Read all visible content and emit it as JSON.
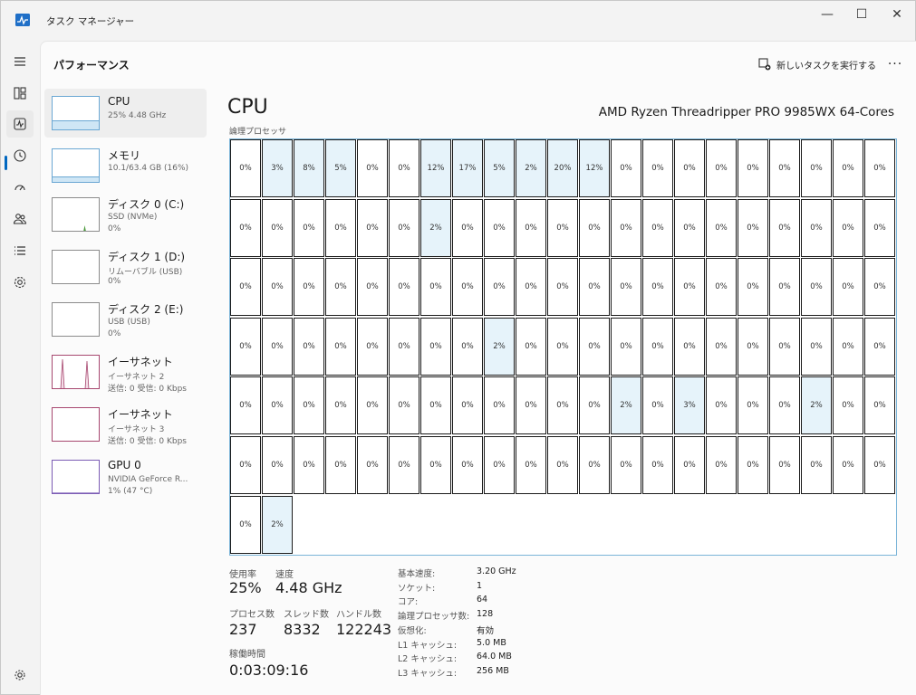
{
  "app": {
    "title": "タスク マネージャー"
  },
  "header": {
    "page_title": "パフォーマンス",
    "run_task_label": "新しいタスクを実行する",
    "more_label": "···"
  },
  "window_controls": {
    "minimize": "—",
    "maximize": "☐",
    "close": "✕"
  },
  "rail": {
    "items": [
      "menu-icon",
      "processes-icon",
      "performance-icon",
      "app-history-icon",
      "startup-icon",
      "users-icon",
      "details-icon",
      "services-icon",
      "settings-icon"
    ]
  },
  "devices": [
    {
      "name": "CPU",
      "sub1": "25%  4.48 GHz",
      "sub2": "",
      "color": "#6aa7d3"
    },
    {
      "name": "メモリ",
      "sub1": "10.1/63.4 GB (16%)",
      "sub2": "",
      "color": "#6aa7d3"
    },
    {
      "name": "ディスク 0 (C:)",
      "sub1": "SSD (NVMe)",
      "sub2": "0%",
      "color": "#4d9a3d"
    },
    {
      "name": "ディスク 1 (D:)",
      "sub1": "リムーバブル (USB)",
      "sub2": "0%",
      "color": "#4d9a3d"
    },
    {
      "name": "ディスク 2 (E:)",
      "sub1": "USB (USB)",
      "sub2": "0%",
      "color": "#4d9a3d"
    },
    {
      "name": "イーサネット",
      "sub1": "イーサネット 2",
      "sub2": "送信: 0 受信: 0 Kbps",
      "color": "#a7476f"
    },
    {
      "name": "イーサネット",
      "sub1": "イーサネット 3",
      "sub2": "送信: 0 受信: 0 Kbps",
      "color": "#a7476f"
    },
    {
      "name": "GPU 0",
      "sub1": "NVIDIA GeForce R...",
      "sub2": "1%  (47 °C)",
      "color": "#7b5bb4"
    }
  ],
  "cpu": {
    "title": "CPU",
    "model": "AMD Ryzen Threadripper PRO 9985WX 64-Cores",
    "grid_label": "論理プロセッサ",
    "cores": [
      "0%",
      "3%",
      "8%",
      "5%",
      "0%",
      "0%",
      "12%",
      "17%",
      "5%",
      "2%",
      "20%",
      "12%",
      "0%",
      "0%",
      "0%",
      "0%",
      "0%",
      "0%",
      "0%",
      "0%",
      "0%",
      "0%",
      "0%",
      "0%",
      "0%",
      "0%",
      "0%",
      "2%",
      "0%",
      "0%",
      "0%",
      "0%",
      "0%",
      "0%",
      "0%",
      "0%",
      "0%",
      "0%",
      "0%",
      "0%",
      "0%",
      "0%",
      "0%",
      "0%",
      "0%",
      "0%",
      "0%",
      "0%",
      "0%",
      "0%",
      "0%",
      "0%",
      "0%",
      "0%",
      "0%",
      "0%",
      "0%",
      "0%",
      "0%",
      "0%",
      "0%",
      "0%",
      "0%",
      "0%",
      "0%",
      "0%",
      "0%",
      "0%",
      "0%",
      "0%",
      "0%",
      "2%",
      "0%",
      "0%",
      "0%",
      "0%",
      "0%",
      "0%",
      "0%",
      "0%",
      "0%",
      "0%",
      "0%",
      "0%",
      "0%",
      "0%",
      "0%",
      "0%",
      "0%",
      "0%",
      "0%",
      "0%",
      "0%",
      "0%",
      "0%",
      "0%",
      "2%",
      "0%",
      "3%",
      "0%",
      "0%",
      "0%",
      "2%",
      "0%",
      "0%",
      "0%",
      "0%",
      "0%",
      "0%",
      "0%",
      "0%",
      "0%",
      "0%",
      "0%",
      "0%",
      "0%",
      "0%",
      "0%",
      "0%",
      "0%",
      "0%",
      "0%",
      "0%",
      "0%",
      "0%",
      "0%",
      "0%",
      "2%"
    ],
    "stats": {
      "util_label": "使用率",
      "util_value": "25%",
      "speed_label": "速度",
      "speed_value": "4.48 GHz",
      "proc_label": "プロセス数",
      "proc_value": "237",
      "thread_label": "スレッド数",
      "thread_value": "8332",
      "handle_label": "ハンドル数",
      "handle_value": "122243",
      "uptime_label": "稼働時間",
      "uptime_value": "0:03:09:16"
    },
    "info": [
      {
        "k": "基本速度:",
        "v": "3.20 GHz"
      },
      {
        "k": "ソケット:",
        "v": "1"
      },
      {
        "k": "コア:",
        "v": "64"
      },
      {
        "k": "論理プロセッサ数:",
        "v": "128"
      },
      {
        "k": "仮想化:",
        "v": "有効"
      },
      {
        "k": "L1 キャッシュ:",
        "v": "5.0 MB"
      },
      {
        "k": "L2 キャッシュ:",
        "v": "64.0 MB"
      },
      {
        "k": "L3 キャッシュ:",
        "v": "256 MB"
      }
    ]
  }
}
